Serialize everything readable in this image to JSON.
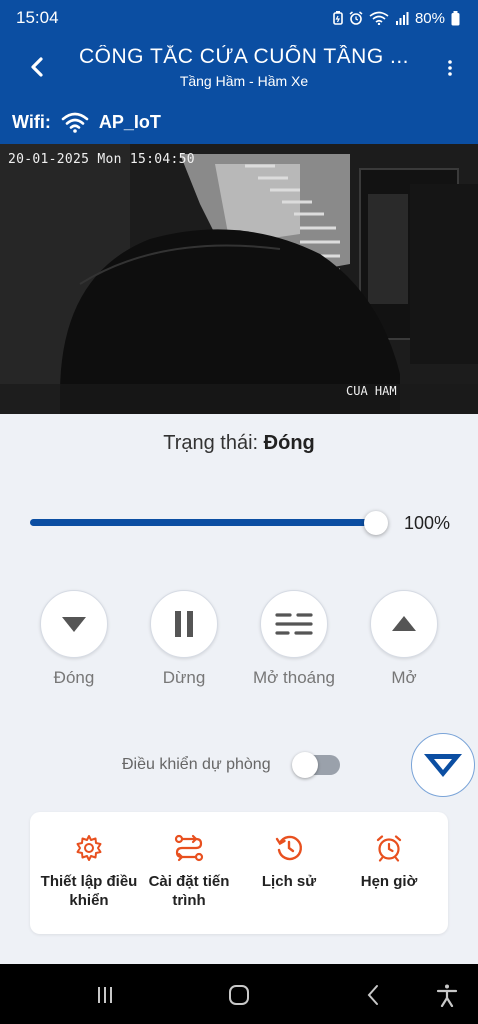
{
  "status_bar": {
    "time": "15:04",
    "battery": "80%",
    "icons": [
      "battery-saver-icon",
      "alarm-icon",
      "wifi-icon",
      "signal-icon",
      "battery-icon"
    ]
  },
  "app_bar": {
    "title": "CÔNG TẮC CỬA CUỐN TẦNG ...",
    "subtitle": "Tầng Hầm - Hầm Xe",
    "back_icon": "chevron-left-icon",
    "menu_icon": "more-vertical-icon"
  },
  "wifi": {
    "label": "Wifi:",
    "ssid": "AP_IoT",
    "icon": "wifi-icon"
  },
  "camera": {
    "timestamp": "20-01-2025 Mon 15:04:50",
    "label": "CUA HAM"
  },
  "state": {
    "label": "Trạng thái:",
    "value": "Đóng"
  },
  "slider": {
    "value": 100,
    "value_label": "100%"
  },
  "controls": [
    {
      "label": "Đóng",
      "icon": "triangle-down-icon"
    },
    {
      "label": "Dừng",
      "icon": "pause-icon"
    },
    {
      "label": "Mở thoáng",
      "icon": "vent-open-icon"
    },
    {
      "label": "Mở",
      "icon": "triangle-up-icon"
    }
  ],
  "backup_control": {
    "label": "Điều khiển dự phòng",
    "enabled": false
  },
  "actions": [
    {
      "label": "Thiết lập điều khiển",
      "icon": "gear-icon"
    },
    {
      "label": "Cài đặt tiến trình",
      "icon": "route-icon"
    },
    {
      "label": "Lịch sử",
      "icon": "history-icon"
    },
    {
      "label": "Hẹn giờ",
      "icon": "alarm-clock-icon"
    }
  ],
  "colors": {
    "brand": "#0b4ea2",
    "accent_orange": "#e8501f",
    "background": "#eef1f6"
  }
}
